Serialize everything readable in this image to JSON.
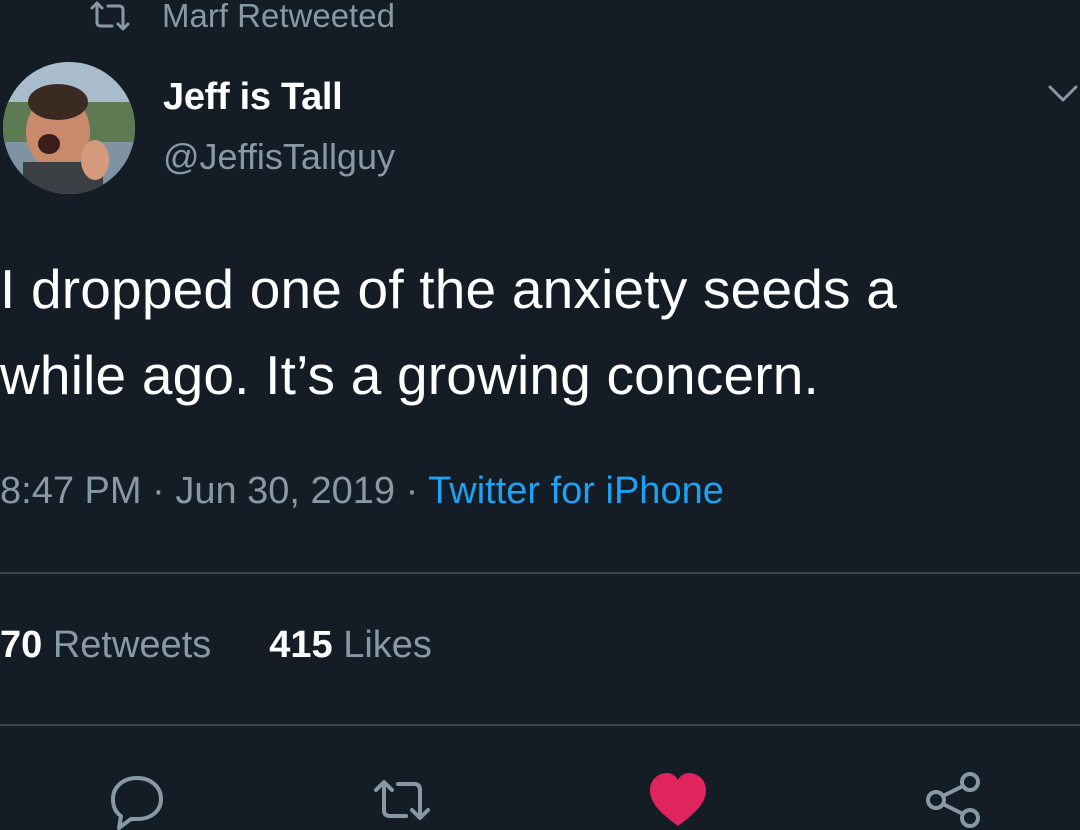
{
  "retweet_context": {
    "icon": "retweet-icon",
    "text": "Marf Retweeted"
  },
  "author": {
    "avatar": "avatar",
    "display_name": "Jeff is Tall",
    "handle": "@JeffisTallguy"
  },
  "menu_icon": "chevron-down-icon",
  "tweet": {
    "text": "I dropped one of the anxiety seeds a\nwhile ago. It’s a growing concern."
  },
  "meta": {
    "time": "8:47 PM",
    "separator": " · ",
    "date": "Jun 30, 2019",
    "source": "Twitter for iPhone"
  },
  "stats": {
    "retweets_count": "70",
    "retweets_label": "Retweets",
    "likes_count": "415",
    "likes_label": "Likes"
  },
  "actions": {
    "reply_icon": "reply-icon",
    "retweet_icon": "retweet-icon",
    "like_icon": "heart-icon",
    "share_icon": "share-icon",
    "like_color": "#e0245e",
    "muted_color": "#8899a6"
  },
  "colors": {
    "background": "#141c26",
    "text": "#ffffff",
    "secondary": "#8899a6",
    "link": "#1da1f2",
    "divider": "#38444d"
  }
}
